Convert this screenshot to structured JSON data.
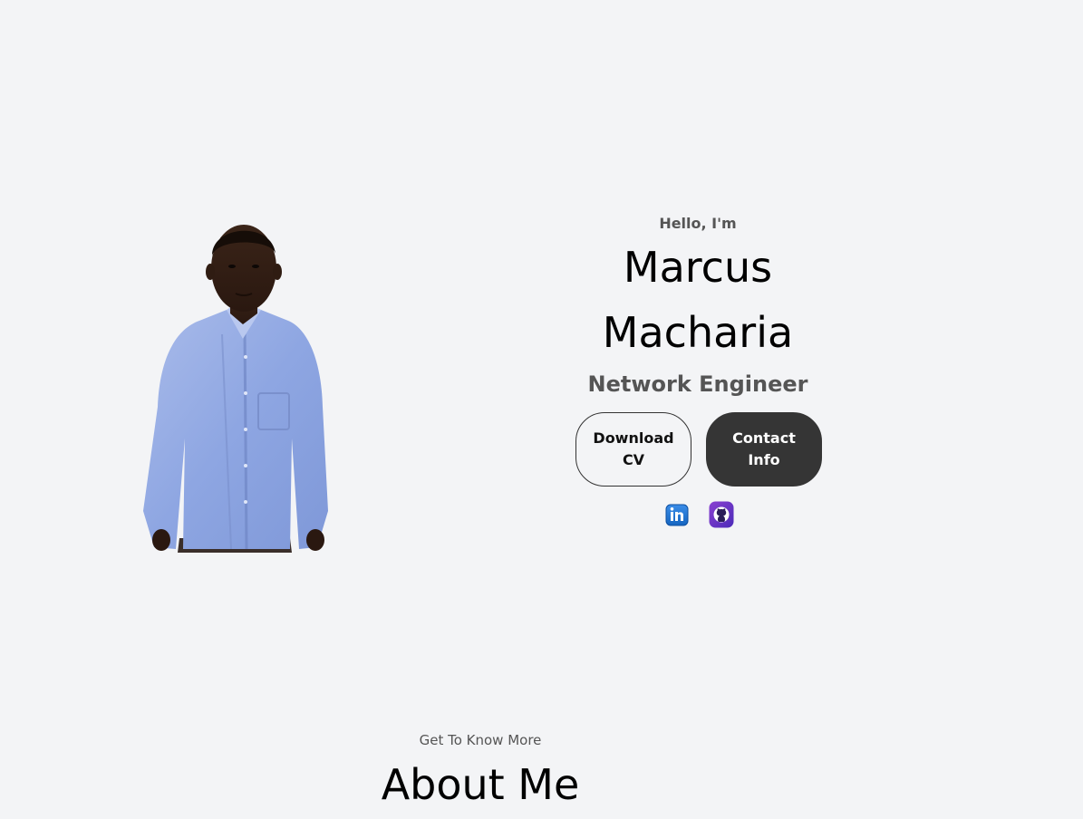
{
  "hero": {
    "greeting": "Hello, I'm",
    "name_first": "Marcus",
    "name_last": "Macharia",
    "role": "Network Engineer",
    "download_cv_label": "Download CV",
    "contact_info_label": "Contact Info",
    "socials": [
      {
        "name": "linkedin-icon"
      },
      {
        "name": "github-icon"
      }
    ]
  },
  "about": {
    "subtitle": "Get To Know More",
    "title": "About Me"
  },
  "colors": {
    "background": "#f3f4f6",
    "solid_button": "#353535",
    "muted_text": "#555555"
  }
}
